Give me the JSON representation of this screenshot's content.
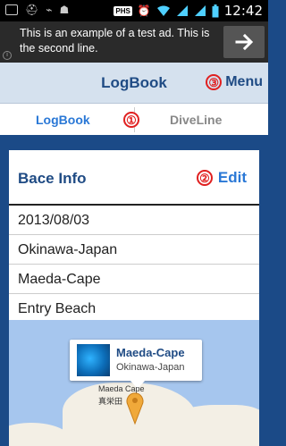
{
  "status_bar": {
    "carrier_badge": "PHS",
    "time": "12:42"
  },
  "ad": {
    "text": "This is an example of a test ad. This is the second line.",
    "info_icon": "info-icon",
    "action_icon": "arrow-right-icon"
  },
  "navbar": {
    "title": "LogBook",
    "menu_label": "Menu",
    "menu_badge": "③"
  },
  "tabs": [
    {
      "label": "LogBook",
      "active": true
    },
    {
      "label": "DiveLine",
      "active": false
    }
  ],
  "tab_badge": "①",
  "card": {
    "title": "Bace Info",
    "edit_label": "Edit",
    "edit_badge": "②",
    "rows": [
      "2013/08/03",
      "Okinawa-Japan",
      "Maeda-Cape",
      "Entry Beach"
    ]
  },
  "map": {
    "popup_title": "Maeda-Cape",
    "popup_subtitle": "Okinawa-Japan",
    "label_en": "Maeda Cape",
    "label_jp": "真栄田"
  },
  "colors": {
    "accent_blue": "#2a78d6",
    "header_blue": "#1f4b84",
    "frame_blue": "#1b4a87",
    "annotation_red": "#e02020",
    "pin_orange": "#f0a93a"
  }
}
